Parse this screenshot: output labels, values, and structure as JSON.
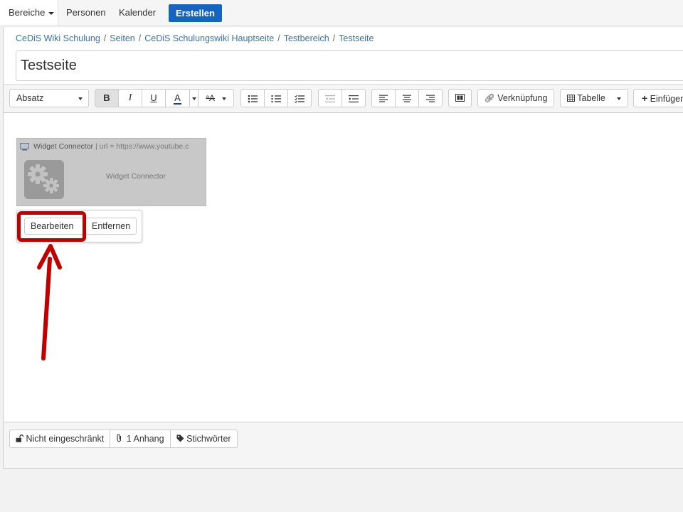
{
  "nav": {
    "bereiche": "Bereiche",
    "personen": "Personen",
    "kalender": "Kalender",
    "erstellen": "Erstellen",
    "erstellen_color": "#1565c0"
  },
  "breadcrumb": [
    "CeDiS Wiki Schulung",
    "Seiten",
    "CeDiS Schulungswiki Hauptseite",
    "Testbereich",
    "Testseite"
  ],
  "title": {
    "value": "Testseite"
  },
  "toolbar": {
    "paragraph_style": "Absatz",
    "bold": "B",
    "italic": "I",
    "underline": "U",
    "text_color": "A",
    "link": "Verknüpfung",
    "table": "Tabelle",
    "insert": "Einfügen"
  },
  "widget": {
    "name": "Widget Connector",
    "url": "| url = https://www.youtube.c",
    "label": "Widget Connector"
  },
  "popup": {
    "edit": "Bearbeiten",
    "remove": "Entfernen"
  },
  "annotation": {
    "color": "#c00000"
  },
  "footer": {
    "restrictions": "Nicht eingeschränkt",
    "attachments": "1 Anhang",
    "labels": "Stichwörter"
  }
}
